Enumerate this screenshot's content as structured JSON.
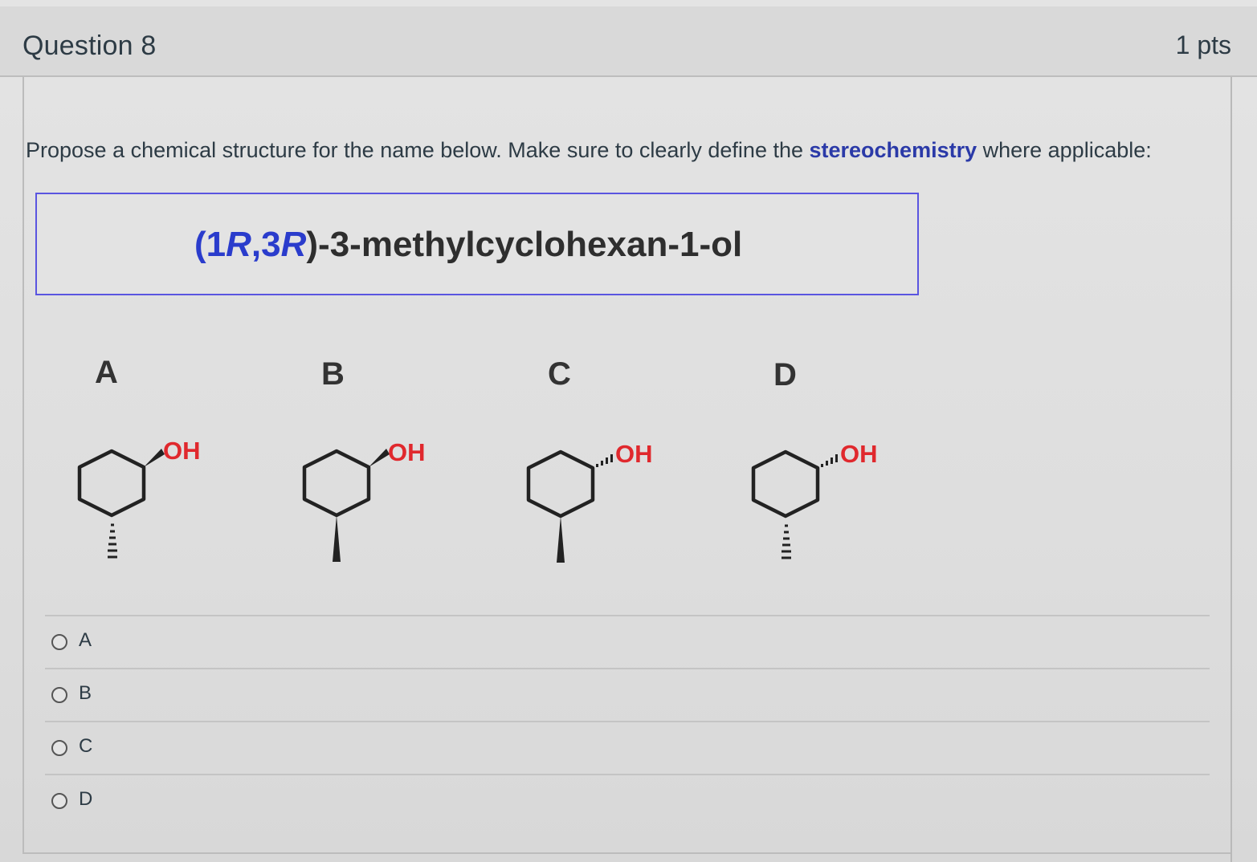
{
  "question": {
    "title": "Question 8",
    "points": "1 pts"
  },
  "prompt": {
    "text_before": "Propose a chemical structure for the name below. Make sure to clearly define the ",
    "emphasis": "stereochemistry",
    "text_after": " where applicable:"
  },
  "compound": {
    "open_paren": "(1",
    "r1": "R",
    "comma": ",3",
    "r2": "R",
    "close": ")",
    "rest": "-3-methylcyclohexan-1-ol"
  },
  "structures": [
    {
      "label": "A",
      "oh_label": "OH",
      "oh_bond": "wedge",
      "methyl_bond": "hash"
    },
    {
      "label": "B",
      "oh_label": "OH",
      "oh_bond": "wedge",
      "methyl_bond": "wedge"
    },
    {
      "label": "C",
      "oh_label": "OH",
      "oh_bond": "hash",
      "methyl_bond": "wedge"
    },
    {
      "label": "D",
      "oh_label": "OH",
      "oh_bond": "hash",
      "methyl_bond": "hash"
    }
  ],
  "options": [
    "A",
    "B",
    "C",
    "D"
  ],
  "colors": {
    "accent": "#2a3ccc",
    "oh_red": "#e0282d",
    "box_border": "#5a55e0"
  }
}
